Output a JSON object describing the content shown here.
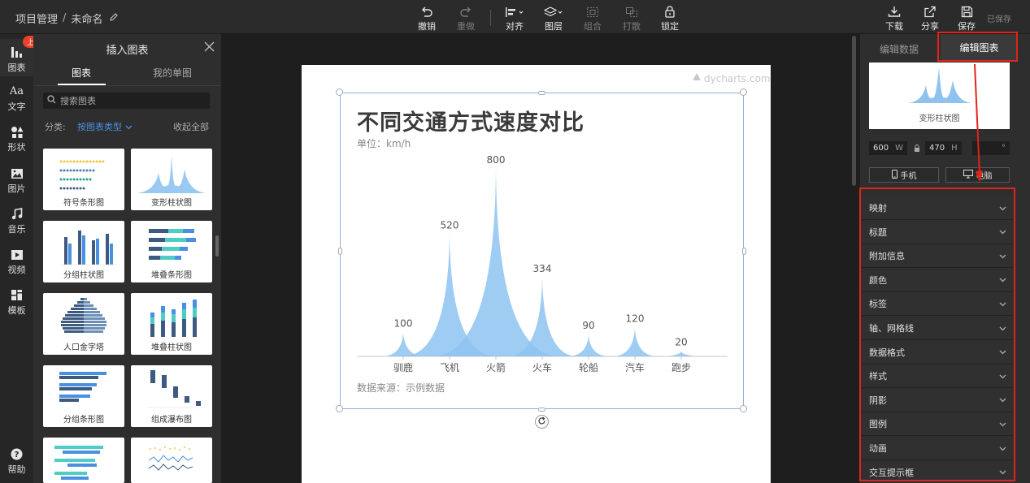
{
  "topbar": {
    "breadcrumb_root": "项目管理",
    "breadcrumb_sep": "/",
    "doc_name": "未命名",
    "tools": [
      {
        "label": "撤销",
        "icon": "undo-icon"
      },
      {
        "label": "重做",
        "icon": "redo-icon"
      },
      {
        "label": "对齐",
        "icon": "align-icon"
      },
      {
        "label": "图层",
        "icon": "layers-icon"
      },
      {
        "label": "组合",
        "icon": "group-icon"
      },
      {
        "label": "打散",
        "icon": "ungroup-icon"
      },
      {
        "label": "锁定",
        "icon": "lock-icon"
      }
    ],
    "right_tools": [
      {
        "label": "下载",
        "icon": "download-icon"
      },
      {
        "label": "分享",
        "icon": "share-icon"
      },
      {
        "label": "保存",
        "icon": "save-icon"
      }
    ],
    "saved_status": "已保存"
  },
  "rail": {
    "new_badge": "上新",
    "items": [
      {
        "label": "图表",
        "icon": "chart-icon"
      },
      {
        "label": "文字",
        "icon": "text-icon",
        "glyph": "Aa"
      },
      {
        "label": "形状",
        "icon": "shape-icon"
      },
      {
        "label": "图片",
        "icon": "image-icon"
      },
      {
        "label": "音乐",
        "icon": "music-icon"
      },
      {
        "label": "视频",
        "icon": "video-icon"
      },
      {
        "label": "模板",
        "icon": "template-icon"
      }
    ],
    "help": "帮助"
  },
  "insert_panel": {
    "title": "插入图表",
    "tabs": [
      "图表",
      "我的单图"
    ],
    "search_placeholder": "搜索图表",
    "filter_label": "分类:",
    "filter_value": "按图表类型",
    "collapse_all": "收起全部",
    "cards": [
      "符号条形图",
      "变形柱状图",
      "分组柱状图",
      "堆叠条形图",
      "人口金字塔",
      "堆叠柱状图",
      "分组条形图",
      "组成瀑布图",
      "",
      ""
    ]
  },
  "canvas": {
    "watermark": "dycharts.com",
    "source_text": "数据来源：示例数据"
  },
  "chart_data": {
    "type": "bar",
    "title": "不同交通方式速度对比",
    "subtitle": "单位：km/h",
    "categories": [
      "驯鹿",
      "飞机",
      "火箭",
      "火车",
      "轮船",
      "汽车",
      "跑步"
    ],
    "values": [
      100,
      520,
      800,
      334,
      90,
      120,
      20
    ],
    "ylim": [
      0,
      800
    ],
    "color": "#8ec3f0",
    "grid": false,
    "legend": false
  },
  "right_panel": {
    "tab_data": "编辑数据",
    "tab_edit": "编辑图表",
    "preview_caption": "变形柱状图",
    "width": "600",
    "width_unit": "W",
    "height": "470",
    "height_unit": "H",
    "angle_unit": "°",
    "device_phone": "手机",
    "device_pc": "电脑",
    "sections": [
      "映射",
      "标题",
      "附加信息",
      "颜色",
      "标签",
      "轴、网格线",
      "数据格式",
      "样式",
      "阴影",
      "图例",
      "动画",
      "交互提示框"
    ]
  }
}
